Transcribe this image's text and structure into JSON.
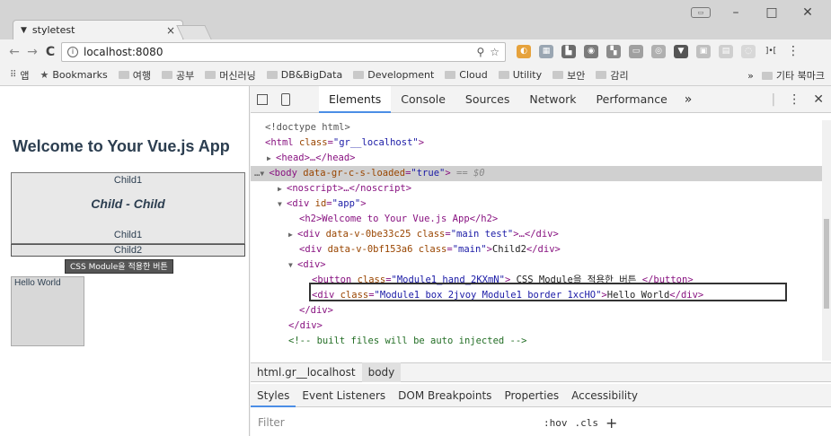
{
  "browser": {
    "tab_title": "styletest",
    "tab_close": "×",
    "url": "localhost:8080",
    "window_minimize": "–",
    "window_maximize": "□",
    "window_close": "✕",
    "nav_back": "←",
    "nav_forward": "→",
    "nav_reload": "C",
    "zoom_icon": "🔍",
    "star_icon": "☆",
    "menu_icon": "⋮"
  },
  "bookmarks": {
    "apps_label": "앱",
    "items": [
      "Bookmarks",
      "여행",
      "공부",
      "머신러닝",
      "DB&BigData",
      "Development",
      "Cloud",
      "Utility",
      "보안",
      "감리"
    ],
    "overflow": "»",
    "other": "기타 북마크"
  },
  "page": {
    "heading": "Welcome to Your Vue.js App",
    "child1_top": "Child1",
    "child_child": "Child - Child",
    "child1_bottom": "Child1",
    "child2": "Child2",
    "css_module_button": "CSS Module을 적용한 버튼",
    "hello_world": "Hello World"
  },
  "devtools": {
    "tabs": [
      "Elements",
      "Console",
      "Sources",
      "Network",
      "Performance"
    ],
    "active_tab": "Elements",
    "more_tabs": "»",
    "menu": "⋮",
    "close": "✕",
    "dom": {
      "doctype": "<!doctype html>",
      "html_open_tag": "html",
      "html_class_attr": "class",
      "html_class_val": "\"gr__localhost\"",
      "head_collapsed": "<head>…</head>",
      "body_tag": "body",
      "body_attr": "data-gr-c-s-loaded",
      "body_val": "\"true\"",
      "body_eq": "== $0",
      "noscript": "<noscript>…</noscript>",
      "div_app": "div",
      "div_app_attr": "id",
      "div_app_val": "\"app\"",
      "h2_line": "<h2>Welcome to Your Vue.js App</h2>",
      "div_main_test_attr1": "data-v-0be33c25",
      "div_main_test_attr2": "class",
      "div_main_test_val2": "\"main test\"",
      "div_main_test_rest": ">…</div>",
      "div_main_attr1": "data-v-0bf153a6",
      "div_main_attr2": "class",
      "div_main_val2": "\"main\"",
      "div_main_text": "Child2",
      "div_plain": "<div>",
      "button_class_attr": "class",
      "button_class_val": "\"Module1_hand_2KXmN\"",
      "button_text": " CSS Module을 적용한 버튼 ",
      "div_box_class_attr": "class",
      "div_box_class_val": "\"Module1_box_2jvoy Module1_border_1xcHO\"",
      "div_box_text": "Hello World",
      "div_close_inner": "</div>",
      "div_close_outer": "</div>",
      "comment": "<!-- built files will be auto injected -->"
    },
    "breadcrumbs": [
      "html.gr__localhost",
      "body"
    ],
    "subtabs": [
      "Styles",
      "Event Listeners",
      "DOM Breakpoints",
      "Properties",
      "Accessibility"
    ],
    "filter_placeholder": "Filter",
    "hov": ":hov",
    "cls": ".cls",
    "plus": "+"
  }
}
